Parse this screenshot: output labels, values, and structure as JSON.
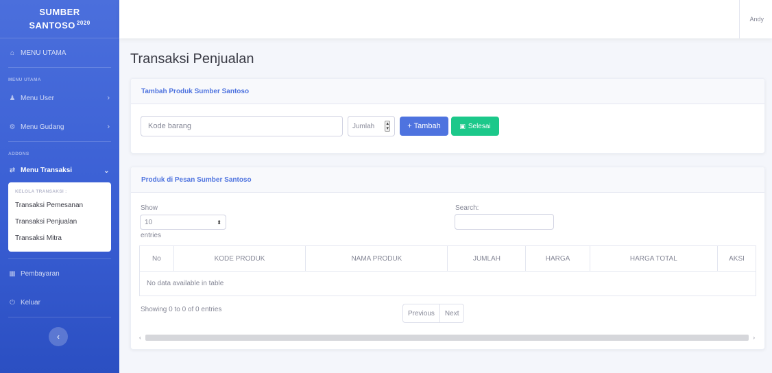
{
  "brand": {
    "name": "SUMBER",
    "name2": "SANTOSO",
    "year": "2020"
  },
  "sidebar": {
    "menu_utama": "MENU UTAMA",
    "heading_main": "MENU UTAMA",
    "menu_user": "Menu User",
    "menu_gudang": "Menu Gudang",
    "heading_addons": "ADDONS",
    "menu_transaksi": "Menu Transaksi",
    "submenu_heading": "KELOLA TRANSAKSI :",
    "submenu_items": [
      "Transaksi Pemesanan",
      "Transaksi Penjualan",
      "Transaksi Mitra"
    ],
    "pembayaran": "Pembayaran",
    "keluar": "Keluar"
  },
  "topbar": {
    "user": "Andy"
  },
  "page_title": "Transaksi Penjualan",
  "add_card": {
    "title": "Tambah Produk Sumber Santoso",
    "kode_placeholder": "Kode barang",
    "jumlah_placeholder": "Jumlah",
    "tambah_label": "+ Tambah",
    "selesai_label": "Selesai"
  },
  "order_card": {
    "title": "Produk di Pesan Sumber Santoso",
    "show_label": "Show",
    "entries_value": "10",
    "entries_label": "entries",
    "search_label": "Search:",
    "columns": [
      "No",
      "KODE PRODUK",
      "NAMA PRODUK",
      "JUMLAH",
      "HARGA",
      "HARGA TOTAL",
      "AKSI"
    ],
    "empty_text": "No data available in table",
    "info_text": "Showing 0 to 0 of 0 entries",
    "previous": "Previous",
    "next": "Next"
  },
  "colors": {
    "primary": "#4e73df",
    "success": "#1cc88a",
    "sidebar": "#3a5fd4"
  }
}
